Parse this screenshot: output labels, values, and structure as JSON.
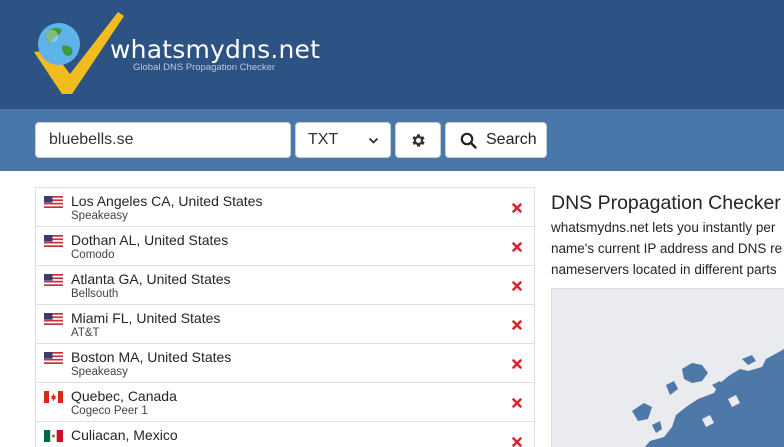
{
  "header": {
    "brand": "whatsmydns.net",
    "tagline": "Global DNS Propagation Checker"
  },
  "search": {
    "domain": "bluebells.se",
    "record_type": "TXT",
    "search_label": "Search"
  },
  "servers": [
    {
      "location": "Los Angeles CA, United States",
      "provider": "Speakeasy",
      "flag": "us"
    },
    {
      "location": "Dothan AL, United States",
      "provider": "Comodo",
      "flag": "us"
    },
    {
      "location": "Atlanta GA, United States",
      "provider": "Bellsouth",
      "flag": "us"
    },
    {
      "location": "Miami FL, United States",
      "provider": "AT&T",
      "flag": "us"
    },
    {
      "location": "Boston MA, United States",
      "provider": "Speakeasy",
      "flag": "us"
    },
    {
      "location": "Quebec, Canada",
      "provider": "Cogeco Peer 1",
      "flag": "ca"
    },
    {
      "location": "Culiacan, Mexico",
      "provider": "",
      "flag": "mx"
    }
  ],
  "info": {
    "title": "DNS Propagation Checker",
    "lines": [
      "whatsmydns.net lets you instantly per",
      "name's current IP address and DNS re",
      "nameservers located in different parts"
    ]
  },
  "colors": {
    "header_bg": "#2c5384",
    "searchbar_bg": "#4a77a9",
    "fail": "#d9232e",
    "map_land": "#4d78a8"
  }
}
